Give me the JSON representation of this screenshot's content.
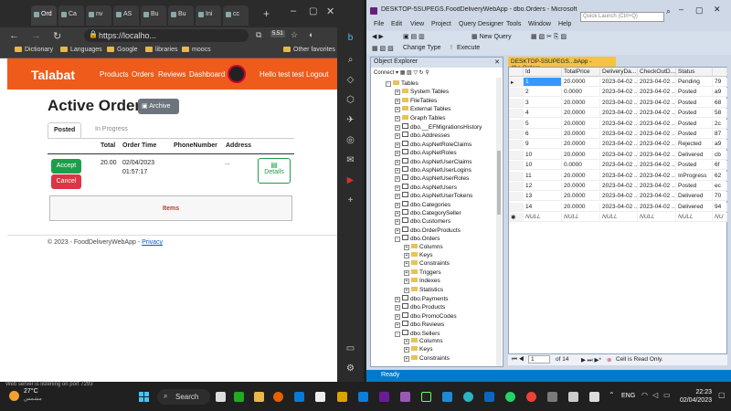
{
  "browser": {
    "tabs": [
      "Ord",
      "Ca",
      "nv",
      "AS",
      "Bu",
      "Bu",
      "Ini",
      "cc"
    ],
    "url": "https://localho...",
    "bookmarks": [
      "Dictionary",
      "Languages",
      "Google",
      "libraries",
      "moocs",
      "Other favorites"
    ],
    "ext_badge": "5.51"
  },
  "app": {
    "brand": "Talabat",
    "nav": [
      "Products",
      "Orders",
      "Reviews",
      "Dashboard"
    ],
    "greeting": "Hello test test",
    "logout": "Logout",
    "heading": "Active Orders",
    "archive": "Archive",
    "tabs": {
      "posted": "Posted",
      "in_progress": "In Progress"
    },
    "table": {
      "headers": [
        "Total",
        "Order Time",
        "PhoneNumber",
        "Address"
      ],
      "row": {
        "total": "20.00",
        "time_line1": "02/04/2023",
        "time_line2": "01:57:17",
        "phone": "",
        "address": "..."
      },
      "accept": "Accept",
      "cancel": "Cancel",
      "details": "Details"
    },
    "items": "Items",
    "footer": "© 2023 - FoodDeliveryWebApp -",
    "privacy": "Privacy"
  },
  "ssms": {
    "title": "DESKTOP-5SUPEGS.FoodDeliveryWebApp - dbo.Orders - Microsoft SQL S...",
    "quick_launch": "Quick Launch (Ctrl+Q)",
    "menu": [
      "File",
      "Edit",
      "View",
      "Project",
      "Query Designer",
      "Tools",
      "Window",
      "Help"
    ],
    "toolbar": {
      "new_query": "New Query",
      "change_type": "Change Type",
      "execute": "Execute"
    },
    "object_explorer": {
      "title": "Object Explorer",
      "connect": "Connect",
      "nodes": [
        {
          "label": "Tables",
          "type": "folder",
          "indent": 0,
          "exp": "-"
        },
        {
          "label": "System Tables",
          "type": "folder",
          "indent": 1,
          "exp": "+"
        },
        {
          "label": "FileTables",
          "type": "folder",
          "indent": 1,
          "exp": "+"
        },
        {
          "label": "External Tables",
          "type": "folder",
          "indent": 1,
          "exp": "+"
        },
        {
          "label": "Graph Tables",
          "type": "folder",
          "indent": 1,
          "exp": "+"
        },
        {
          "label": "dbo.__EFMigrationsHistory",
          "type": "table",
          "indent": 1,
          "exp": "+"
        },
        {
          "label": "dbo.Addresses",
          "type": "table",
          "indent": 1,
          "exp": "+"
        },
        {
          "label": "dbo.AspNetRoleClaims",
          "type": "table",
          "indent": 1,
          "exp": "+"
        },
        {
          "label": "dbo.AspNetRoles",
          "type": "table",
          "indent": 1,
          "exp": "+"
        },
        {
          "label": "dbo.AspNetUserClaims",
          "type": "table",
          "indent": 1,
          "exp": "+"
        },
        {
          "label": "dbo.AspNetUserLogins",
          "type": "table",
          "indent": 1,
          "exp": "+"
        },
        {
          "label": "dbo.AspNetUserRoles",
          "type": "table",
          "indent": 1,
          "exp": "+"
        },
        {
          "label": "dbo.AspNetUsers",
          "type": "table",
          "indent": 1,
          "exp": "+"
        },
        {
          "label": "dbo.AspNetUserTokens",
          "type": "table",
          "indent": 1,
          "exp": "+"
        },
        {
          "label": "dbo.Categories",
          "type": "table",
          "indent": 1,
          "exp": "+"
        },
        {
          "label": "dbo.CategorySeller",
          "type": "table",
          "indent": 1,
          "exp": "+"
        },
        {
          "label": "dbo.Customers",
          "type": "table",
          "indent": 1,
          "exp": "+"
        },
        {
          "label": "dbo.OrderProducts",
          "type": "table",
          "indent": 1,
          "exp": "+"
        },
        {
          "label": "dbo.Orders",
          "type": "table",
          "indent": 1,
          "exp": "-"
        },
        {
          "label": "Columns",
          "type": "folder",
          "indent": 2,
          "exp": "+"
        },
        {
          "label": "Keys",
          "type": "folder",
          "indent": 2,
          "exp": "+"
        },
        {
          "label": "Constraints",
          "type": "folder",
          "indent": 2,
          "exp": "+"
        },
        {
          "label": "Triggers",
          "type": "folder",
          "indent": 2,
          "exp": "+"
        },
        {
          "label": "Indexes",
          "type": "folder",
          "indent": 2,
          "exp": "+"
        },
        {
          "label": "Statistics",
          "type": "folder",
          "indent": 2,
          "exp": "+"
        },
        {
          "label": "dbo.Payments",
          "type": "table",
          "indent": 1,
          "exp": "+"
        },
        {
          "label": "dbo.Products",
          "type": "table",
          "indent": 1,
          "exp": "+"
        },
        {
          "label": "dbo.PromoCodes",
          "type": "table",
          "indent": 1,
          "exp": "+"
        },
        {
          "label": "dbo.Reviews",
          "type": "table",
          "indent": 1,
          "exp": "+"
        },
        {
          "label": "dbo.Sellers",
          "type": "table",
          "indent": 1,
          "exp": "-"
        },
        {
          "label": "Columns",
          "type": "folder",
          "indent": 2,
          "exp": "+"
        },
        {
          "label": "Keys",
          "type": "folder",
          "indent": 2,
          "exp": "+"
        },
        {
          "label": "Constraints",
          "type": "folder",
          "indent": 2,
          "exp": "+"
        }
      ]
    },
    "grid": {
      "tab_title": "DESKTOP-5SUPEGS...bApp - dbo.Orders",
      "columns": [
        "Id",
        "TotalPrice",
        "DeliveryDa...",
        "CheckOutD...",
        "Status",
        ""
      ],
      "rows": [
        [
          "1",
          "20.0000",
          "2023-04-02 ...",
          "2023-04-02 ...",
          "Pending",
          "79"
        ],
        [
          "2",
          "0.0000",
          "2023-04-02 ...",
          "2023-04-02 ...",
          "Posted",
          "a9"
        ],
        [
          "3",
          "20.0000",
          "2023-04-02 ...",
          "2023-04-02 ...",
          "Posted",
          "68"
        ],
        [
          "4",
          "20.0000",
          "2023-04-02 ...",
          "2023-04-02 ...",
          "Posted",
          "58"
        ],
        [
          "5",
          "20.0000",
          "2023-04-02 ...",
          "2023-04-02 ...",
          "Posted",
          "2c"
        ],
        [
          "6",
          "20.0000",
          "2023-04-02 ...",
          "2023-04-02 ...",
          "Posted",
          "87"
        ],
        [
          "9",
          "20.0000",
          "2023-04-02 ...",
          "2023-04-02 ...",
          "Rejected",
          "a9"
        ],
        [
          "10",
          "20.0000",
          "2023-04-02 ...",
          "2023-04-02 ...",
          "Delivered",
          "cb"
        ],
        [
          "10",
          "0.0000",
          "2023-04-02 ...",
          "2023-04-02 ...",
          "Posted",
          "6f"
        ],
        [
          "11",
          "20.0000",
          "2023-04-02 ...",
          "2023-04-02 ...",
          "InProgress",
          "62"
        ],
        [
          "12",
          "20.0000",
          "2023-04-02 ...",
          "2023-04-02 ...",
          "Posted",
          "ec"
        ],
        [
          "13",
          "20.0000",
          "2023-04-02 ...",
          "2023-04-02 ...",
          "Delivered",
          "70"
        ],
        [
          "14",
          "20.0000",
          "2023-04-02 ...",
          "2023-04-02 ...",
          "Delivered",
          "94"
        ],
        [
          "NULL",
          "NULL",
          "NULL",
          "NULL",
          "NULL",
          "NU"
        ]
      ],
      "nav_page": "1",
      "nav_of": "of 14",
      "readonly": "Cell is Read Only."
    },
    "status": "Ready"
  },
  "taskbar": {
    "temp": "27°C",
    "weather": "مشمس",
    "search": "Search",
    "lang": "ENG",
    "time": "22:23",
    "date": "02/04/2023",
    "web_server_note": "Web server is listening on port 7293"
  },
  "colors": {
    "brand": "#ee5b1b",
    "accept": "#1e9e4a",
    "cancel": "#dc3545",
    "vs_blue": "#007acc"
  }
}
